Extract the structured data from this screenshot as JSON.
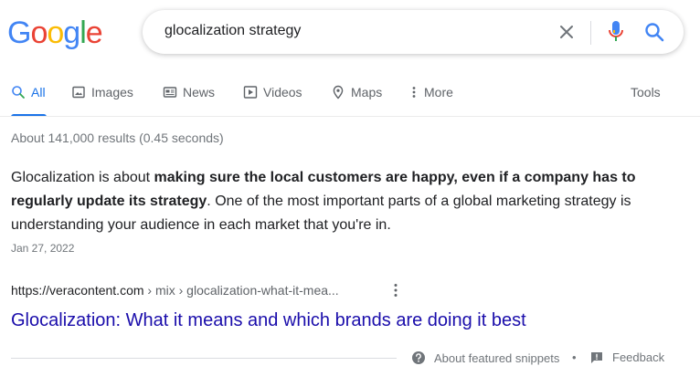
{
  "logo": {
    "letters": [
      "G",
      "o",
      "o",
      "g",
      "l",
      "e"
    ],
    "colors": [
      "#4285F4",
      "#EA4335",
      "#FBBC05",
      "#4285F4",
      "#34A853",
      "#EA4335"
    ]
  },
  "search": {
    "query": "glocalization strategy"
  },
  "tabs": [
    {
      "label": "All",
      "icon": "search-icon",
      "active": true
    },
    {
      "label": "Images",
      "icon": "image-icon"
    },
    {
      "label": "News",
      "icon": "news-icon"
    },
    {
      "label": "Videos",
      "icon": "play-icon"
    },
    {
      "label": "Maps",
      "icon": "location-pin-icon"
    },
    {
      "label": "More",
      "icon": "kebab-icon"
    }
  ],
  "tools_label": "Tools",
  "stats": "About 141,000 results (0.45 seconds)",
  "snippet": {
    "part1": "Glocalization is about ",
    "bold": "making sure the local customers are happy, even if a company has to regularly update its strategy",
    "part2": ". One of the most important parts of a global marketing strategy is understanding your audience in each market that you're in.",
    "date": "Jan 27, 2022"
  },
  "result": {
    "domain": "https://veracontent.com",
    "path": " › mix › glocalization-what-it-mea...",
    "title": "Glocalization: What it means and which brands are doing it best"
  },
  "footer": {
    "about": "About featured snippets",
    "bullet": "•",
    "feedback": "Feedback"
  },
  "colors": {
    "accent": "#1a73e8",
    "link": "#1a0dab",
    "muted": "#70757a"
  }
}
